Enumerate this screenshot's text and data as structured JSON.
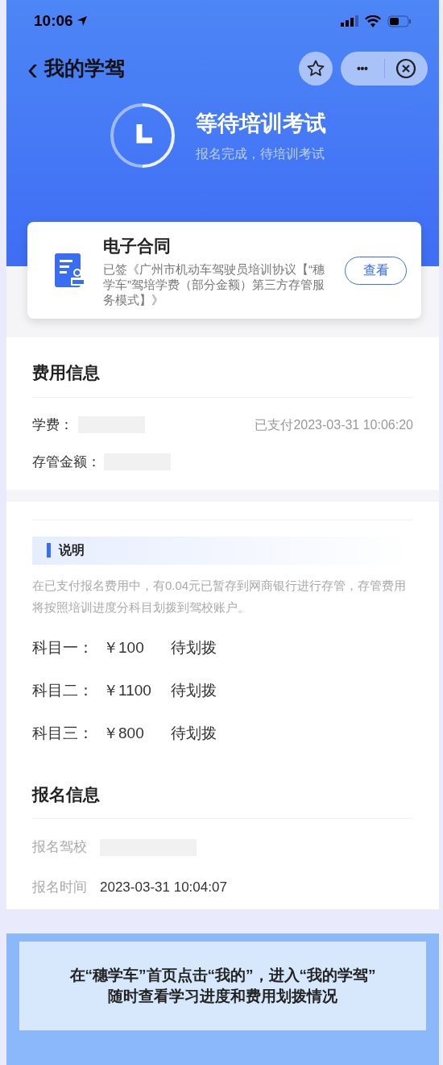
{
  "status_bar": {
    "time": "10:06"
  },
  "nav": {
    "back_icon": "‹",
    "title": "我的学驾",
    "more": "•••"
  },
  "status": {
    "title": "等待培训考试",
    "subtitle": "报名完成，待培训考试"
  },
  "contract": {
    "title": "电子合同",
    "description": "已签《广州市机动车驾驶员培训协议【“穗学车”驾培学费（部分金额）第三方存管服务模式】》",
    "button": "查看"
  },
  "fee_info": {
    "title": "费用信息",
    "rows": [
      {
        "label": "学费：",
        "note": "已支付2023-03-31 10:06:20"
      },
      {
        "label": "存管金额："
      }
    ]
  },
  "explanation": {
    "title": "说明",
    "text": "在已支付报名费用中，有0.04元已暂存到网商银行进行存管，存管费用将按照培训进度分科目划拨到驾校账户。",
    "subjects": [
      {
        "label": "科目一：",
        "amount": "￥100",
        "status": "待划拨"
      },
      {
        "label": "科目二：",
        "amount": "￥1100",
        "status": "待划拨"
      },
      {
        "label": "科目三：",
        "amount": "￥800",
        "status": "待划拨"
      }
    ]
  },
  "registration": {
    "title": "报名信息",
    "rows": [
      {
        "label": "报名驾校"
      },
      {
        "label": "报名时间",
        "value": "2023-03-31 10:04:07"
      }
    ]
  },
  "banner": {
    "lines": [
      "在“穗学车”首页点击“我的”，进入“我的学驾”",
      "随时查看学习进度和费用划拨情况"
    ]
  }
}
